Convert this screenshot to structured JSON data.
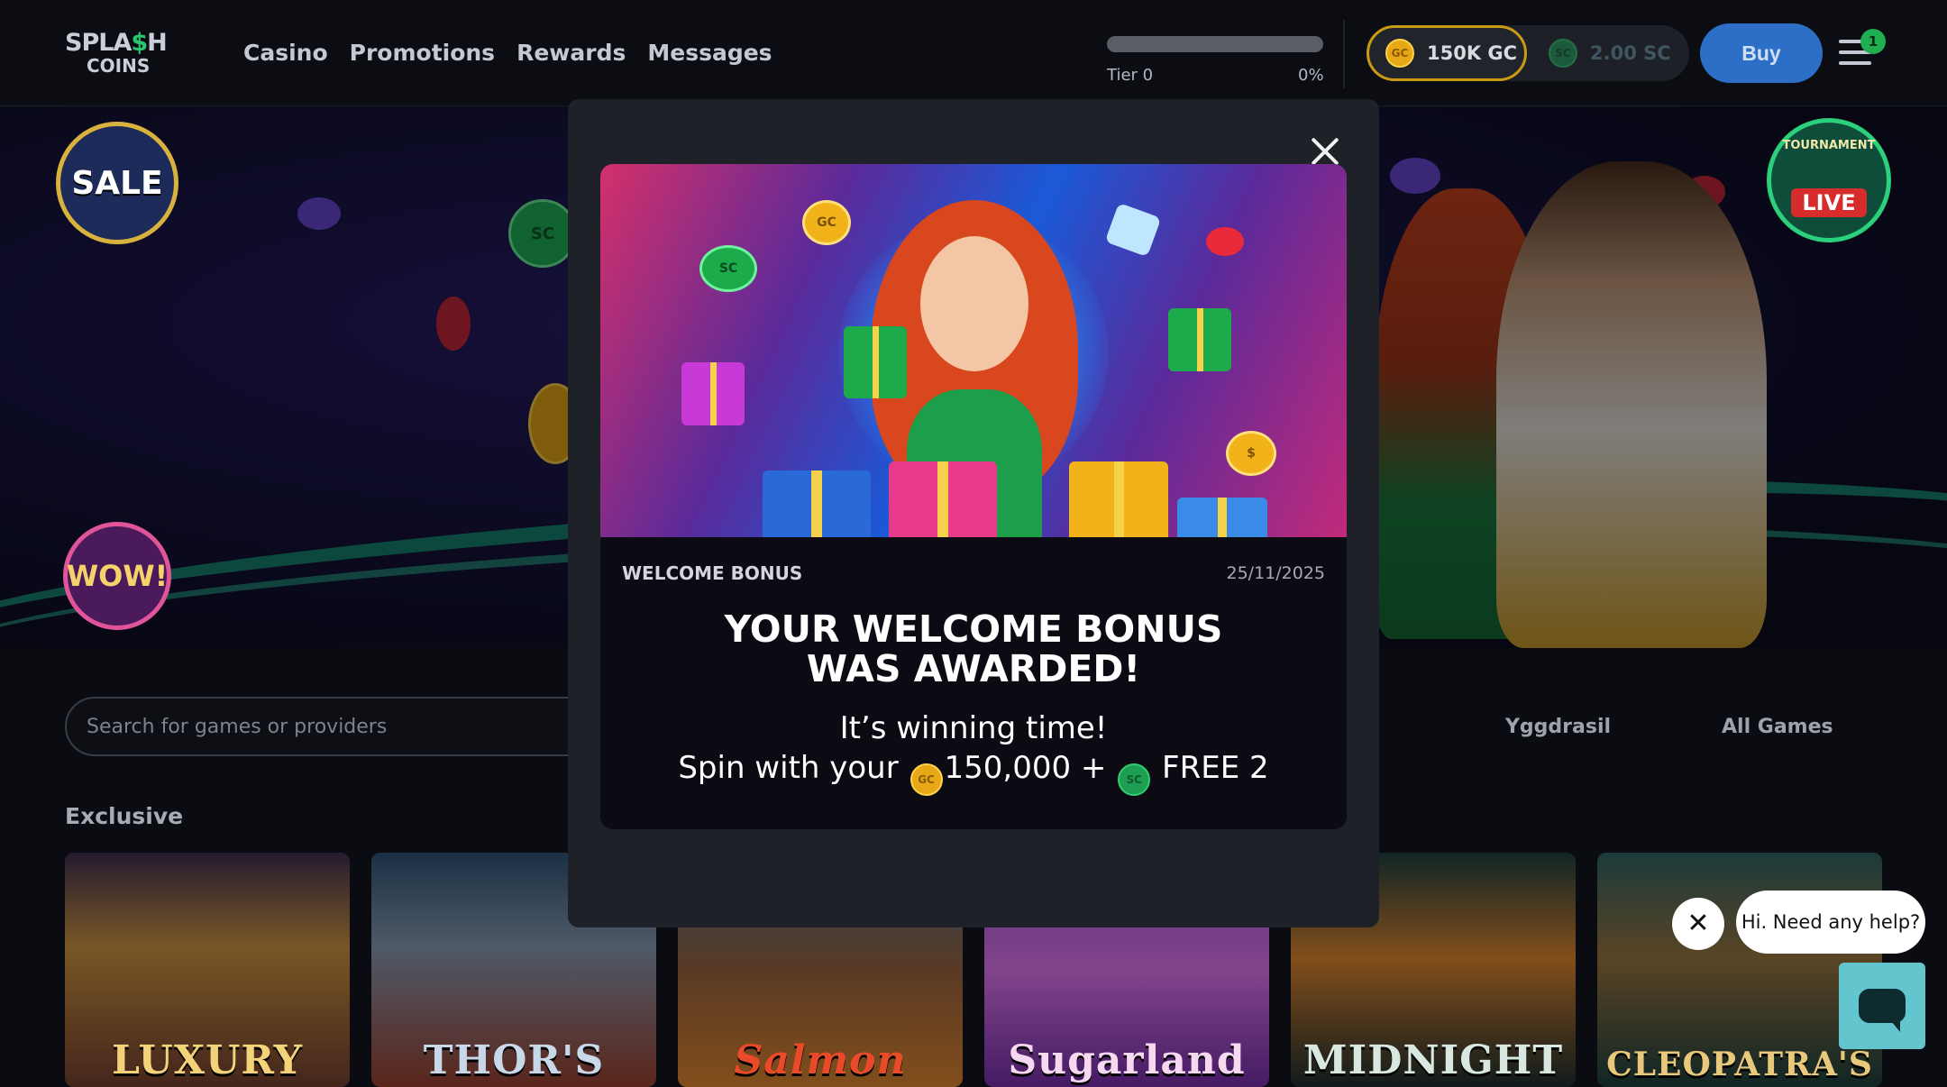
{
  "header": {
    "logo_line1_a": "SPLA",
    "logo_line1_b": "$",
    "logo_line1_c": "H",
    "logo_line2": "COINS",
    "nav": [
      "Casino",
      "Promotions",
      "Rewards",
      "Messages"
    ],
    "tier_label": "Tier 0",
    "tier_percent_label": "0%",
    "tier_progress": 0,
    "gc_balance": "150K GC",
    "sc_balance": "2.00 SC",
    "gc_icon_text": "GC",
    "sc_icon_text": "SC",
    "buy_label": "Buy",
    "menu_badge": "1"
  },
  "hero": {
    "sale_badge": "SALE",
    "wow_badge": "WOW!",
    "tournament_badge_top": "TOURNAMENT",
    "tournament_badge_live": "LIVE"
  },
  "lobby": {
    "search_placeholder": "Search for games or providers",
    "providers": [
      "Yggdrasil",
      "All Games"
    ],
    "section_title": "Exclusive",
    "games": [
      "LUXURY",
      "THOR'S",
      "Salmon",
      "Sugarland",
      "MIDNIGHT",
      "CLEOPATRA'S"
    ]
  },
  "modal": {
    "label": "WELCOME BONUS",
    "date": "25/11/2025",
    "headline_line1": "YOUR WELCOME BONUS",
    "headline_line2": "WAS AWARDED!",
    "sub_line1": "It’s winning time!",
    "sub_line2_prefix": "Spin with your",
    "sub_gc_amount": "150,000 +",
    "sub_sc_amount": "FREE 2"
  },
  "chat": {
    "greeting": "Hi. Need any help?"
  },
  "colors": {
    "accent_blue": "#2d6fc7",
    "gold": "#c99a14",
    "green": "#1fae52",
    "chat_teal": "#63c6cf"
  },
  "icons": [
    "close-icon",
    "hamburger-menu-icon",
    "gold-coin-icon",
    "sweeps-coin-icon",
    "chat-icon"
  ]
}
